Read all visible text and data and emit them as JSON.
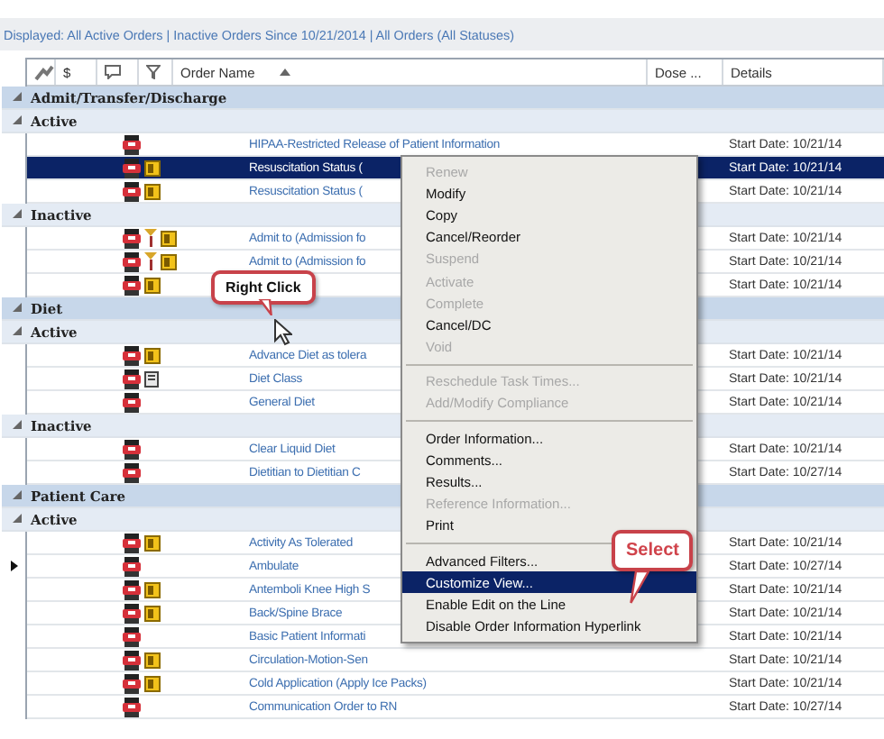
{
  "filter_bar": {
    "text": "Displayed: All Active Orders | Inactive Orders Since 10/21/2014 | All Orders (All Statuses)"
  },
  "table": {
    "columns": [
      {
        "label": "$"
      },
      {
        "label": "Order Name",
        "sorted": true
      },
      {
        "label": "Dose ..."
      },
      {
        "label": "Details"
      }
    ],
    "rows": [
      {
        "kind": "group",
        "label": "Admit/Transfer/Discharge",
        "expanded": true
      },
      {
        "kind": "subgroup",
        "label": "Active",
        "expanded": true
      },
      {
        "kind": "order",
        "name": "HIPAA-Restricted Release of Patient Information",
        "details": "Start Date: 10/21/14",
        "icons": [
          {
            "kind": "order"
          }
        ],
        "selected": false,
        "current": false
      },
      {
        "kind": "order",
        "name": "Resuscitation Status (",
        "details": "Start Date: 10/21/14",
        "icons": [
          {
            "kind": "order"
          },
          {
            "kind": "note"
          }
        ],
        "selected": true,
        "current": false
      },
      {
        "kind": "order",
        "name": "Resuscitation Status (",
        "details": "Start Date: 10/21/14",
        "icons": [
          {
            "kind": "order"
          },
          {
            "kind": "note"
          }
        ],
        "selected": false,
        "current": false
      },
      {
        "kind": "subgroup",
        "label": "Inactive",
        "expanded": true
      },
      {
        "kind": "order",
        "name": "Admit to (Admission fo",
        "details": "Start Date: 10/21/14",
        "icons": [
          {
            "kind": "order"
          },
          {
            "kind": "pin"
          },
          {
            "kind": "note"
          }
        ],
        "selected": false,
        "current": false
      },
      {
        "kind": "order",
        "name": "Admit to (Admission fo",
        "details": "Start Date: 10/21/14",
        "icons": [
          {
            "kind": "order"
          },
          {
            "kind": "pin"
          },
          {
            "kind": "note"
          }
        ],
        "selected": false,
        "current": false
      },
      {
        "kind": "order",
        "details": "Start Date: 10/21/14",
        "icons": [
          {
            "kind": "order"
          },
          {
            "kind": "note"
          }
        ],
        "selected": false,
        "current": false
      },
      {
        "kind": "group",
        "label": "Diet",
        "expanded": true
      },
      {
        "kind": "subgroup",
        "label": "Active",
        "expanded": true
      },
      {
        "kind": "order",
        "name": "Advance Diet as tolera",
        "details": "Start Date: 10/21/14",
        "icons": [
          {
            "kind": "order"
          },
          {
            "kind": "note"
          }
        ],
        "selected": false,
        "current": false
      },
      {
        "kind": "order",
        "name": "Diet Class",
        "details": "Start Date: 10/21/14",
        "icons": [
          {
            "kind": "order"
          },
          {
            "kind": "document"
          }
        ],
        "selected": false,
        "current": false
      },
      {
        "kind": "order",
        "name": "General Diet",
        "details": "Start Date: 10/21/14",
        "icons": [
          {
            "kind": "order"
          }
        ],
        "selected": false,
        "current": false
      },
      {
        "kind": "subgroup",
        "label": "Inactive",
        "expanded": true
      },
      {
        "kind": "order",
        "name": "Clear Liquid Diet",
        "details": "Start Date: 10/21/14",
        "icons": [
          {
            "kind": "order"
          }
        ],
        "selected": false,
        "current": false
      },
      {
        "kind": "order",
        "name": "Dietitian to Dietitian C",
        "details": "Start Date: 10/27/14",
        "icons": [
          {
            "kind": "order"
          }
        ],
        "selected": false,
        "current": false
      },
      {
        "kind": "group",
        "label": "Patient Care",
        "expanded": true
      },
      {
        "kind": "subgroup",
        "label": "Active",
        "expanded": true
      },
      {
        "kind": "order",
        "name": "Activity As Tolerated",
        "details": "Start Date: 10/21/14",
        "icons": [
          {
            "kind": "order"
          },
          {
            "kind": "note"
          }
        ],
        "selected": false,
        "current": false
      },
      {
        "kind": "order",
        "name": "Ambulate",
        "details": "Start Date: 10/27/14",
        "icons": [
          {
            "kind": "order"
          }
        ],
        "selected": false,
        "current": true
      },
      {
        "kind": "order",
        "name": "Antemboli Knee High S",
        "details": "Start Date: 10/21/14",
        "icons": [
          {
            "kind": "order"
          },
          {
            "kind": "note"
          }
        ],
        "selected": false,
        "current": false
      },
      {
        "kind": "order",
        "name": "Back/Spine Brace",
        "details": "Start Date: 10/21/14",
        "icons": [
          {
            "kind": "order"
          },
          {
            "kind": "note"
          }
        ],
        "selected": false,
        "current": false
      },
      {
        "kind": "order",
        "name": "Basic Patient Informati",
        "details": "Start Date: 10/21/14",
        "icons": [
          {
            "kind": "order"
          }
        ],
        "selected": false,
        "current": false
      },
      {
        "kind": "order",
        "name": "Circulation-Motion-Sen",
        "details": "Start Date: 10/21/14",
        "icons": [
          {
            "kind": "order"
          },
          {
            "kind": "note"
          }
        ],
        "selected": false,
        "current": false
      },
      {
        "kind": "order",
        "name": "Cold Application (Apply Ice Packs)",
        "details": "Start Date: 10/21/14",
        "icons": [
          {
            "kind": "order"
          },
          {
            "kind": "note"
          }
        ],
        "selected": false,
        "current": false
      },
      {
        "kind": "order",
        "name": "Communication Order to RN",
        "details": "Start Date: 10/27/14",
        "icons": [
          {
            "kind": "order"
          }
        ],
        "selected": false,
        "current": false
      }
    ]
  },
  "context_menu": {
    "items": [
      {
        "kind": "item",
        "label": "Renew",
        "disabled": true,
        "highlighted": false
      },
      {
        "kind": "item",
        "label": "Modify",
        "disabled": false,
        "highlighted": false
      },
      {
        "kind": "item",
        "label": "Copy",
        "disabled": false,
        "highlighted": false
      },
      {
        "kind": "item",
        "label": "Cancel/Reorder",
        "disabled": false,
        "highlighted": false
      },
      {
        "kind": "item",
        "label": "Suspend",
        "disabled": true,
        "highlighted": false
      },
      {
        "kind": "item",
        "label": "Activate",
        "disabled": true,
        "highlighted": false
      },
      {
        "kind": "item",
        "label": "Complete",
        "disabled": true,
        "highlighted": false
      },
      {
        "kind": "item",
        "label": "Cancel/DC",
        "disabled": false,
        "highlighted": false
      },
      {
        "kind": "item",
        "label": "Void",
        "disabled": true,
        "highlighted": false
      },
      {
        "kind": "separator"
      },
      {
        "kind": "item",
        "label": "Reschedule Task Times...",
        "disabled": true,
        "highlighted": false
      },
      {
        "kind": "item",
        "label": "Add/Modify Compliance",
        "disabled": true,
        "highlighted": false
      },
      {
        "kind": "separator"
      },
      {
        "kind": "item",
        "label": "Order Information...",
        "disabled": false,
        "highlighted": false
      },
      {
        "kind": "item",
        "label": "Comments...",
        "disabled": false,
        "highlighted": false
      },
      {
        "kind": "item",
        "label": "Results...",
        "disabled": false,
        "highlighted": false
      },
      {
        "kind": "item",
        "label": "Reference Information...",
        "disabled": true,
        "highlighted": false
      },
      {
        "kind": "item",
        "label": "Print",
        "disabled": false,
        "highlighted": false
      },
      {
        "kind": "separator"
      },
      {
        "kind": "item",
        "label": "Advanced Filters...",
        "disabled": false,
        "highlighted": false
      },
      {
        "kind": "item",
        "label": "Customize View...",
        "disabled": false,
        "highlighted": true
      },
      {
        "kind": "item",
        "label": "Enable Edit on the Line",
        "disabled": false,
        "highlighted": false
      },
      {
        "kind": "item",
        "label": "Disable Order Information Hyperlink",
        "disabled": false,
        "highlighted": false
      }
    ]
  },
  "callouts": [
    {
      "text": "Right Click"
    },
    {
      "text": "Select"
    }
  ]
}
